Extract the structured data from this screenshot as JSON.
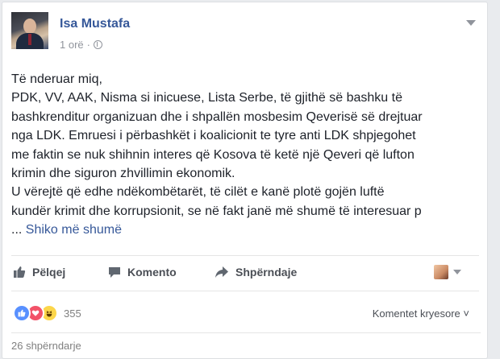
{
  "post": {
    "author": "Isa Mustafa",
    "time": "1 orë",
    "separator": "·",
    "body_lines": [
      "Të nderuar miq,",
      "PDK, VV, AAK, Nisma si inicuese, Lista Serbe, të gjithë së bashku të",
      "bashkrenditur organizuan dhe i shpallën mosbesim Qeverisë së drejtuar",
      "nga LDK. Emruesi i përbashkët i koalicionit te tyre anti LDK shpjegohet",
      "me faktin se nuk shihnin interes që Kosova të ketë një Qeveri që lufton",
      "krimin dhe siguron zhvillimin ekonomik.",
      "U vërejtë që edhe ndëkombëtarët, të cilët e kanë plotë gojën luftë",
      "kundër krimit dhe korrupsionit, se në fakt janë më shumë të interesuar p"
    ],
    "ellipsis": "...",
    "see_more": "Shiko më shumë"
  },
  "actions": {
    "like": "Pëlqej",
    "comment": "Komento",
    "share": "Shpërndaje"
  },
  "reactions": {
    "count": "355",
    "types": [
      "like-icon",
      "love-icon",
      "haha-icon"
    ],
    "top_comments": "Komentet kryesore ˅"
  },
  "shares": "26 shpërndarje",
  "colors": {
    "link": "#365899",
    "muted": "#90949c",
    "like": "#5890ff",
    "love": "#f25268",
    "haha": "#fcd64a"
  }
}
